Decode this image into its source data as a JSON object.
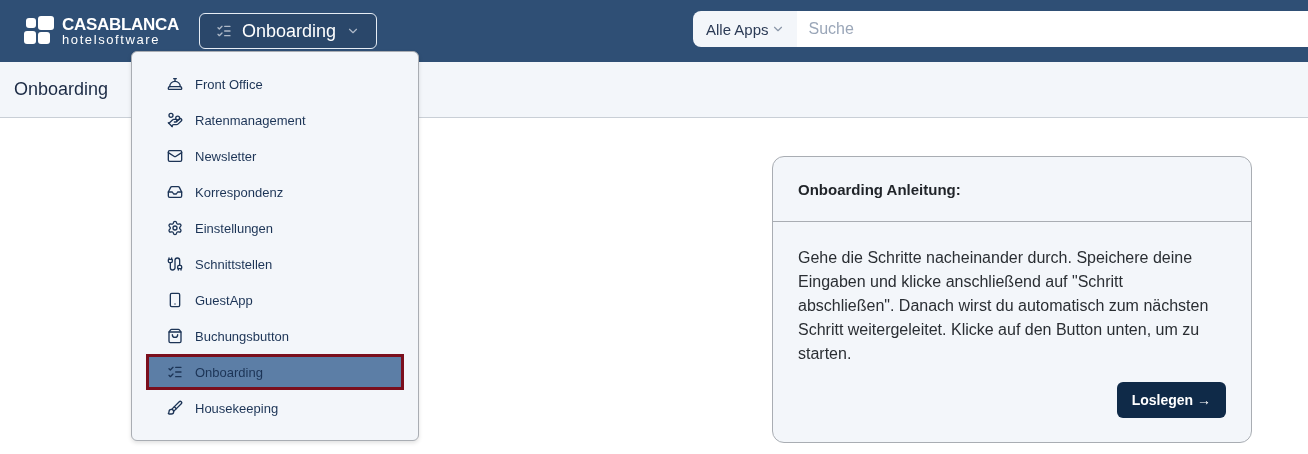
{
  "header": {
    "logo": {
      "title": "CASABLANCA",
      "subtitle": "hotelsoftware"
    },
    "app_switcher": {
      "label": "Onboarding",
      "expanded": true
    },
    "search": {
      "scope": "Alle Apps",
      "placeholder": "Suche"
    }
  },
  "page_title": "Onboarding",
  "app_menu": [
    {
      "label": "Front Office",
      "kind": "bell",
      "selected": false
    },
    {
      "label": "Ratenmanagement",
      "kind": "coins",
      "selected": false
    },
    {
      "label": "Newsletter",
      "kind": "mail",
      "selected": false
    },
    {
      "label": "Korrespondenz",
      "kind": "inbox",
      "selected": false
    },
    {
      "label": "Einstellungen",
      "kind": "gear",
      "selected": false
    },
    {
      "label": "Schnittstellen",
      "kind": "cable",
      "selected": false
    },
    {
      "label": "GuestApp",
      "kind": "phone",
      "selected": false
    },
    {
      "label": "Buchungsbutton",
      "kind": "bag",
      "selected": false
    },
    {
      "label": "Onboarding",
      "kind": "checklist",
      "selected": true
    },
    {
      "label": "Housekeeping",
      "kind": "broom",
      "selected": false
    }
  ],
  "card": {
    "title": "Onboarding Anleitung:",
    "text": "Gehe die Schritte nacheinander durch. Speichere deine Eingaben und klicke anschließend auf \"Schritt abschließen\". Danach wirst du automatisch zum nächsten Schritt weitergeleitet. Klicke auf den Button unten, um zu starten.",
    "button": "Loslegen →"
  }
}
